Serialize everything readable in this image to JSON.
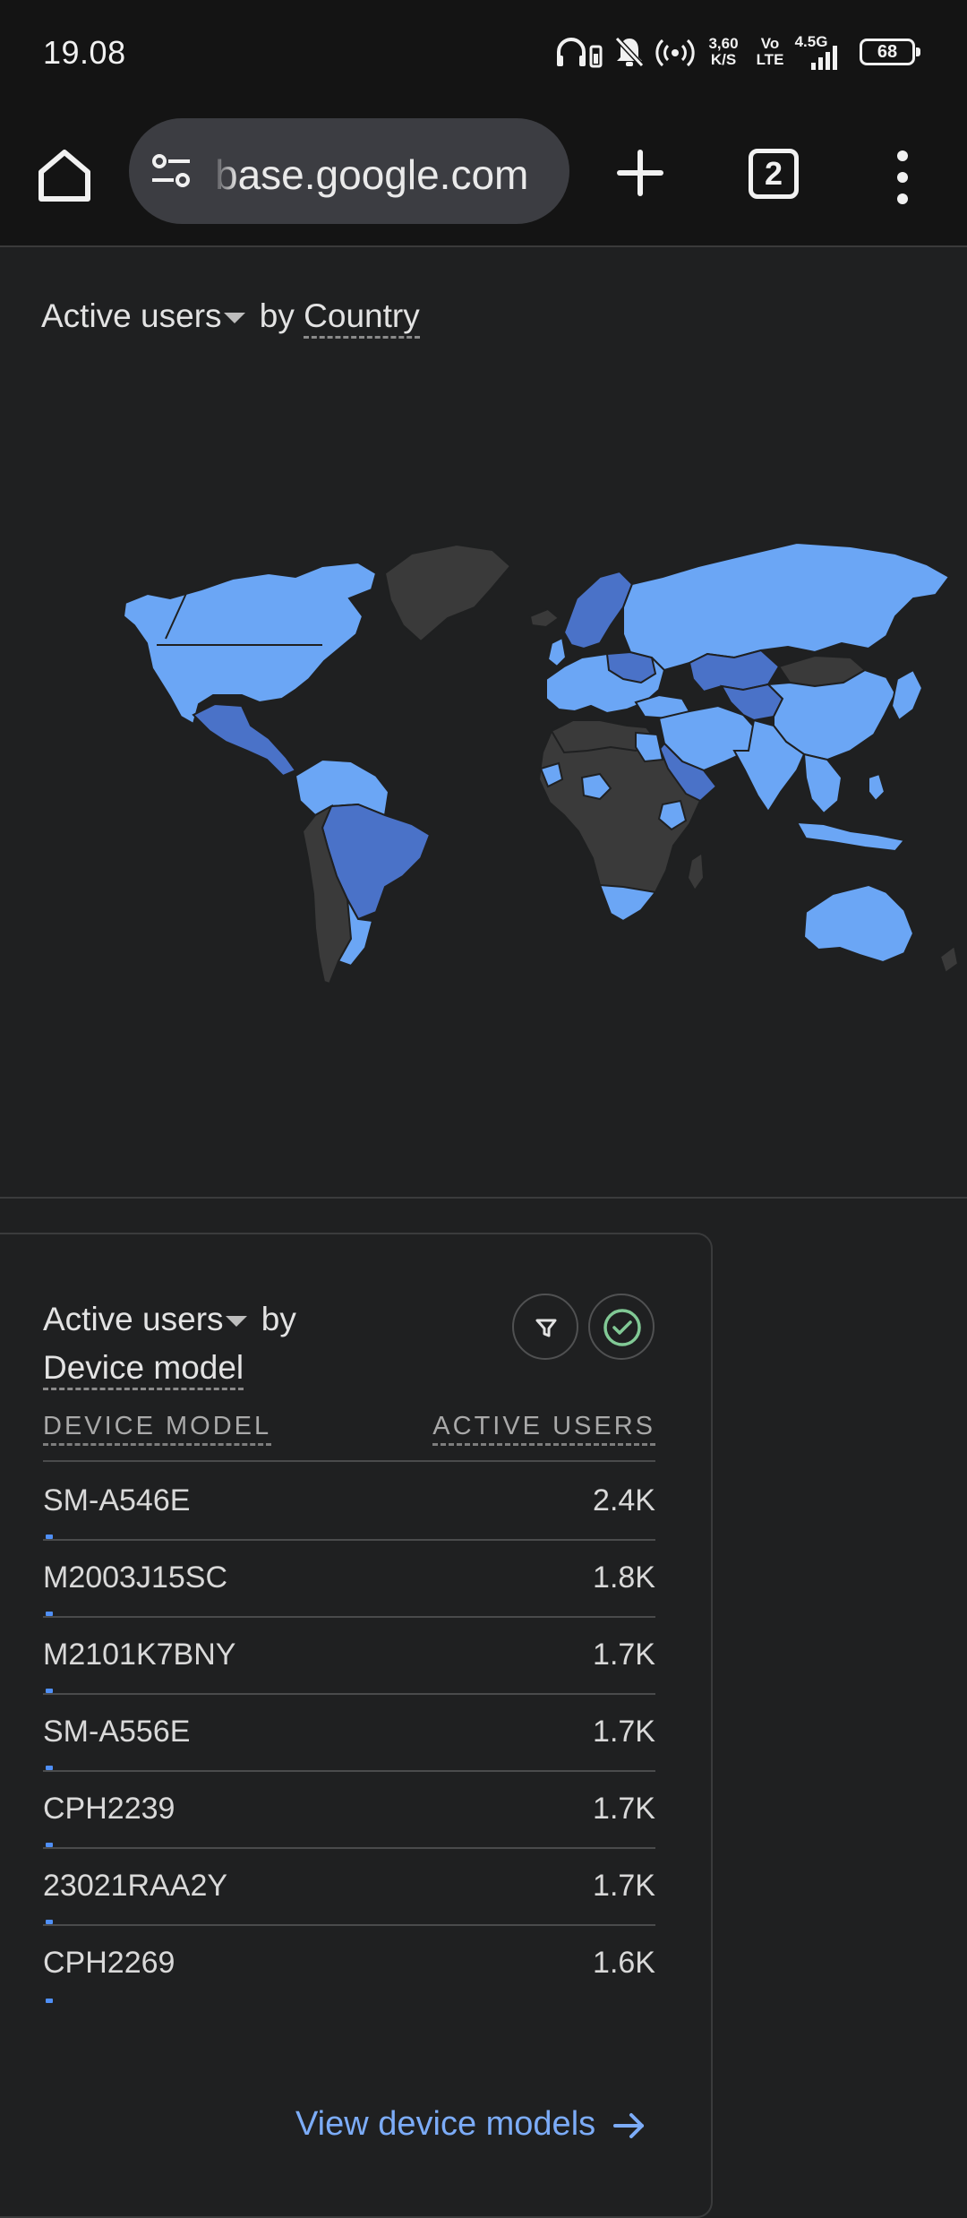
{
  "status_bar": {
    "time": "19.08",
    "net_speed_value": "3,60",
    "net_speed_unit": "K/S",
    "volte_top": "Vo",
    "volte_bottom": "LTE",
    "network_type": "4.5G",
    "battery_level": "68"
  },
  "browser": {
    "url": "base.google.com",
    "tab_count": "2"
  },
  "map_card": {
    "metric": "Active users",
    "by_text": "by",
    "dimension": "Country",
    "colors": {
      "high": "#6ba6f5",
      "medium": "#4a72c8",
      "none": "#3a3a3a"
    }
  },
  "device_card": {
    "metric": "Active users",
    "by_text": "by",
    "dimension": "Device model",
    "columns": [
      "DEVICE MODEL",
      "ACTIVE USERS"
    ],
    "rows": [
      {
        "model": "SM-A546E",
        "users": "2.4K"
      },
      {
        "model": "M2003J15SC",
        "users": "1.8K"
      },
      {
        "model": "M2101K7BNY",
        "users": "1.7K"
      },
      {
        "model": "SM-A556E",
        "users": "1.7K"
      },
      {
        "model": "CPH2239",
        "users": "1.7K"
      },
      {
        "model": "23021RAA2Y",
        "users": "1.7K"
      },
      {
        "model": "CPH2269",
        "users": "1.6K"
      }
    ],
    "view_link": "View device models",
    "accent_color": "#7cacf8"
  }
}
